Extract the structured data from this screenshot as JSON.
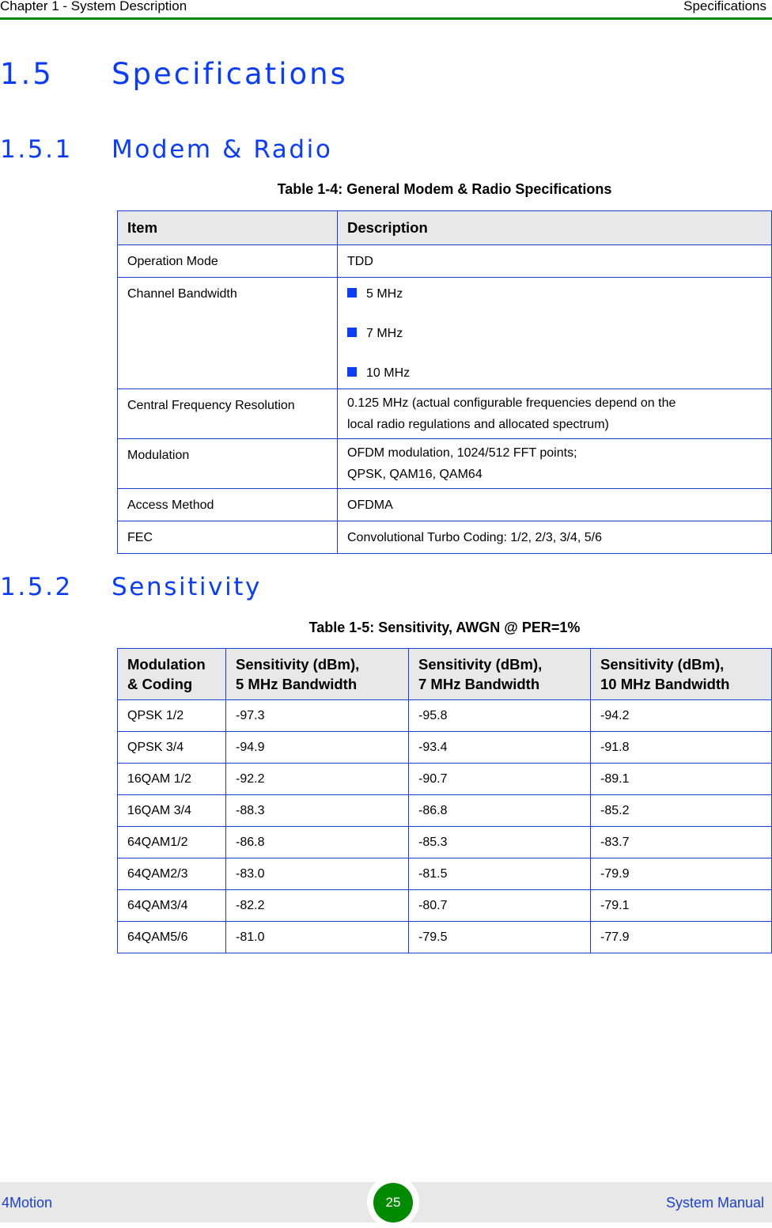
{
  "header": {
    "chapter": "Chapter 1 - System Description",
    "section": "Specifications"
  },
  "section": {
    "number": "1.5",
    "title": "Specifications"
  },
  "subsections": [
    {
      "number": "1.5.1",
      "title": "Modem & Radio"
    },
    {
      "number": "1.5.2",
      "title": "Sensitivity"
    }
  ],
  "table_modem": {
    "caption": "Table 1-4: General Modem & Radio Specifications",
    "headers": [
      "Item",
      "Description"
    ],
    "rows": [
      {
        "item": "Operation Mode",
        "description": "TDD"
      },
      {
        "item": "Channel Bandwidth",
        "bullets": [
          "5 MHz",
          "7 MHz",
          "10 MHz"
        ]
      },
      {
        "item": "Central Frequency Resolution",
        "description_lines": [
          "0.125 MHz (actual configurable frequencies depend on the",
          "local radio regulations and allocated spectrum)"
        ]
      },
      {
        "item": "Modulation",
        "description_lines": [
          "OFDM modulation, 1024/512 FFT points;",
          "QPSK, QAM16, QAM64"
        ]
      },
      {
        "item": "Access Method",
        "description": "OFDMA"
      },
      {
        "item": "FEC",
        "description": "Convolutional Turbo Coding: 1/2, 2/3, 3/4, 5/6"
      }
    ]
  },
  "table_sensitivity": {
    "caption": "Table 1-5: Sensitivity, AWGN @ PER=1%",
    "headers": [
      [
        "Modulation",
        "& Coding"
      ],
      [
        "Sensitivity (dBm),",
        "5 MHz Bandwidth"
      ],
      [
        "Sensitivity (dBm),",
        "7 MHz Bandwidth"
      ],
      [
        "Sensitivity (dBm),",
        "10 MHz Bandwidth"
      ]
    ],
    "rows": [
      [
        "QPSK 1/2",
        "-97.3",
        "-95.8",
        "-94.2"
      ],
      [
        "QPSK 3/4",
        "-94.9",
        "-93.4",
        "-91.8"
      ],
      [
        "16QAM 1/2",
        "-92.2",
        "-90.7",
        "-89.1"
      ],
      [
        "16QAM 3/4",
        "-88.3",
        "-86.8",
        "-85.2"
      ],
      [
        "64QAM1/2",
        "-86.8",
        "-85.3",
        "-83.7"
      ],
      [
        "64QAM2/3",
        "-83.0",
        "-81.5",
        "-79.9"
      ],
      [
        "64QAM3/4",
        "-82.2",
        "-80.7",
        "-79.1"
      ],
      [
        "64QAM5/6",
        "-81.0",
        "-79.5",
        "-77.9"
      ]
    ]
  },
  "footer": {
    "product": "4Motion",
    "page_number": "25",
    "doc_title": "System Manual"
  },
  "colors": {
    "heading_blue": "#0a3cff",
    "rule_green": "#008a00",
    "table_border": "#1a3fd6",
    "header_fill": "#e8e8e8"
  }
}
